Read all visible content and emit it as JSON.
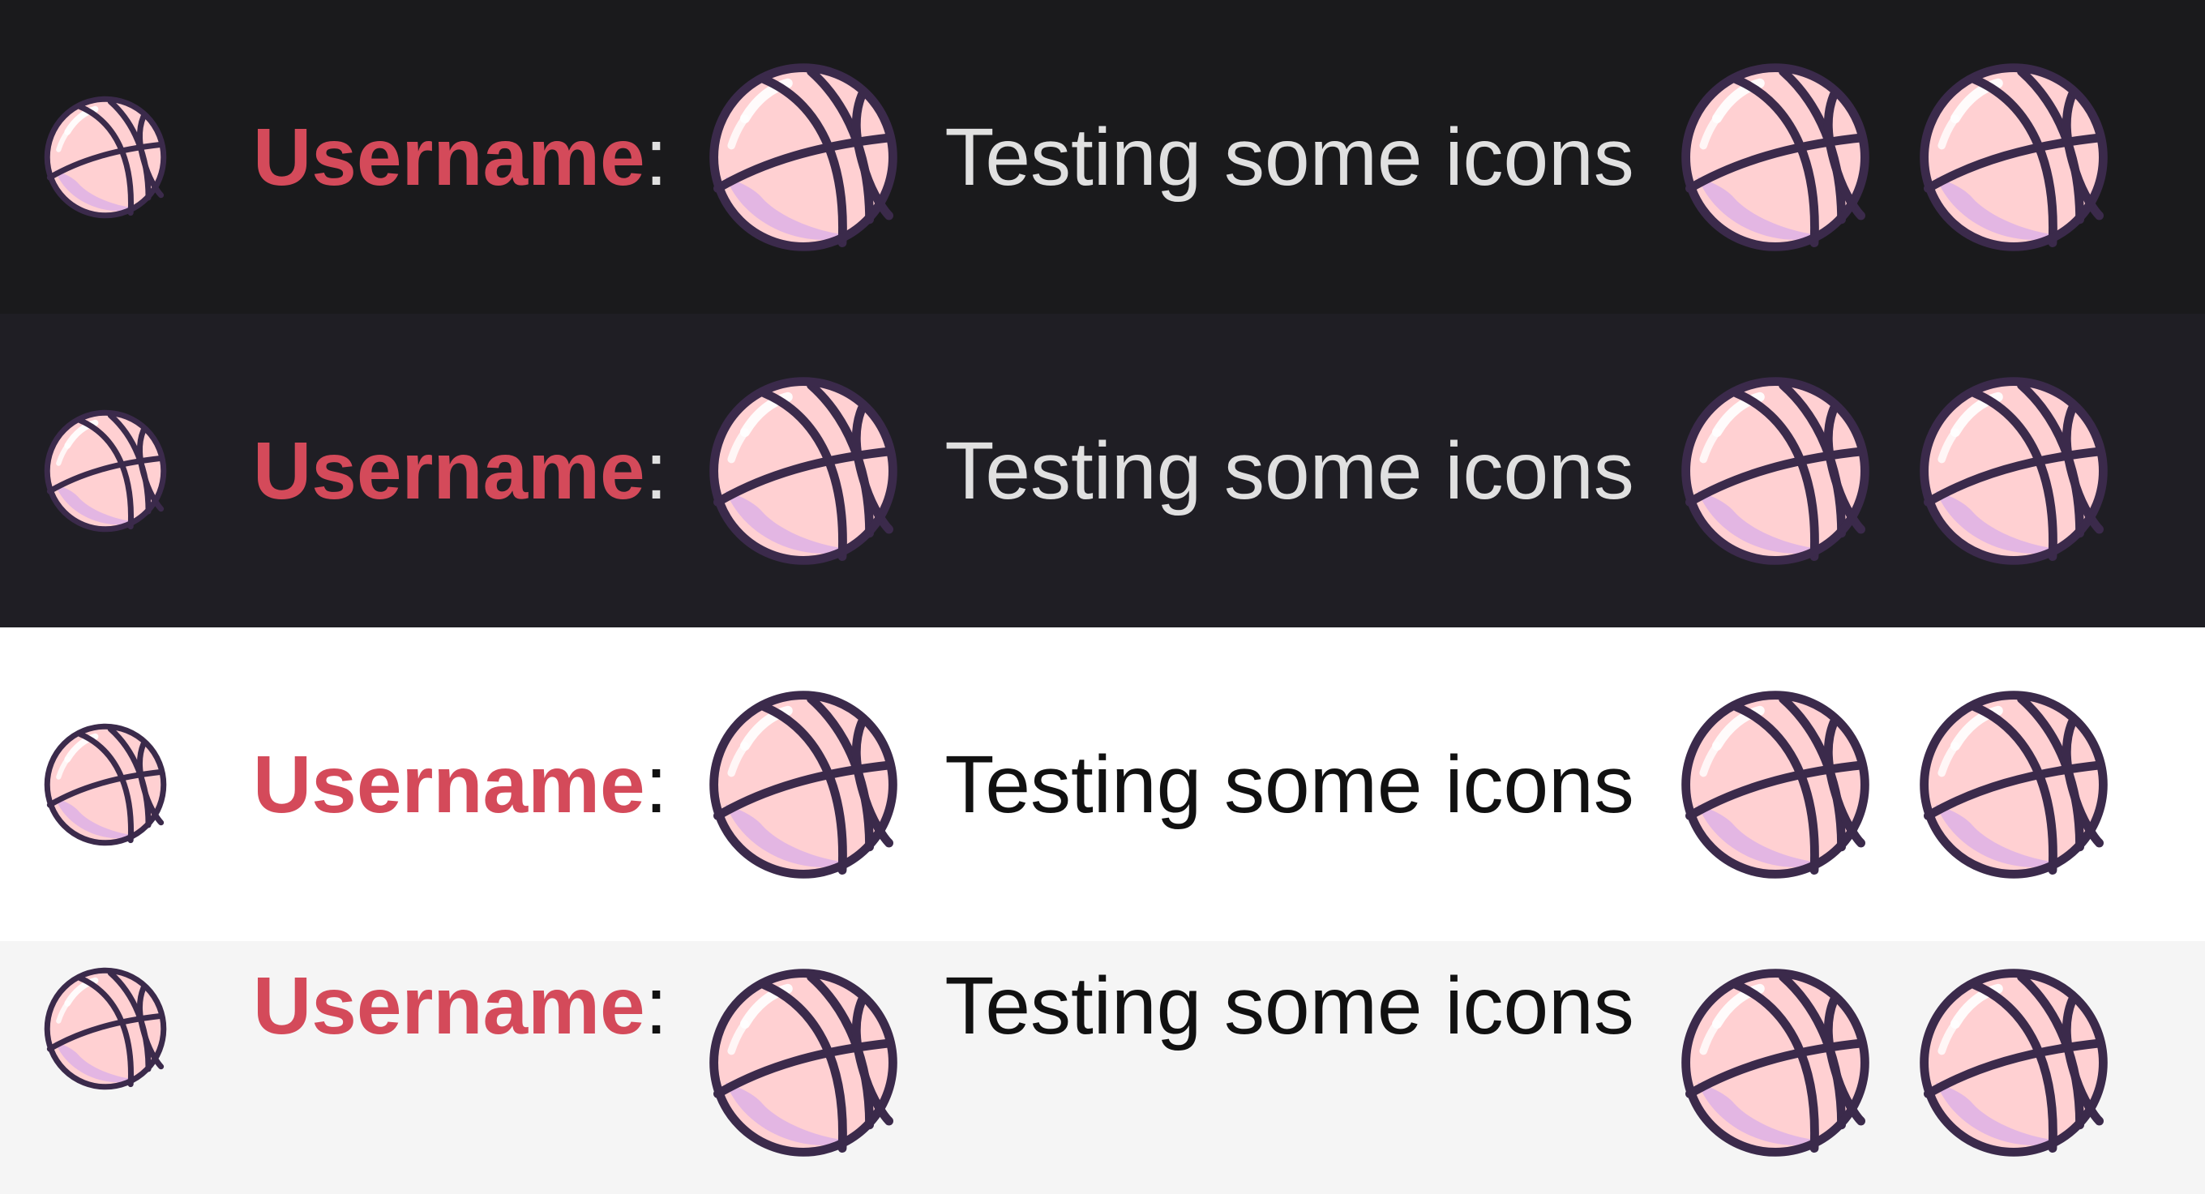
{
  "icon_name": "basketball-icon",
  "colors": {
    "username": "#d44a5a",
    "ball_fill": "#ffd0d2",
    "ball_stroke": "#3b2a4b",
    "ball_shadow": "#e1b4e4"
  },
  "rows": [
    {
      "theme": "dark",
      "background": "#1a1a1c",
      "text_color": "#e0e0e0",
      "username": "Username",
      "separator": ":",
      "message": "Testing some icons"
    },
    {
      "theme": "dark-alt",
      "background": "#1f1e24",
      "text_color": "#e0e0e0",
      "username": "Username",
      "separator": ":",
      "message": "Testing some icons"
    },
    {
      "theme": "light",
      "background": "#ffffff",
      "text_color": "#111111",
      "username": "Username",
      "separator": ":",
      "message": "Testing some icons"
    },
    {
      "theme": "light-alt",
      "background": "#f5f5f5",
      "text_color": "#111111",
      "username": "Username",
      "separator": ":",
      "message": "Testing some icons"
    }
  ]
}
